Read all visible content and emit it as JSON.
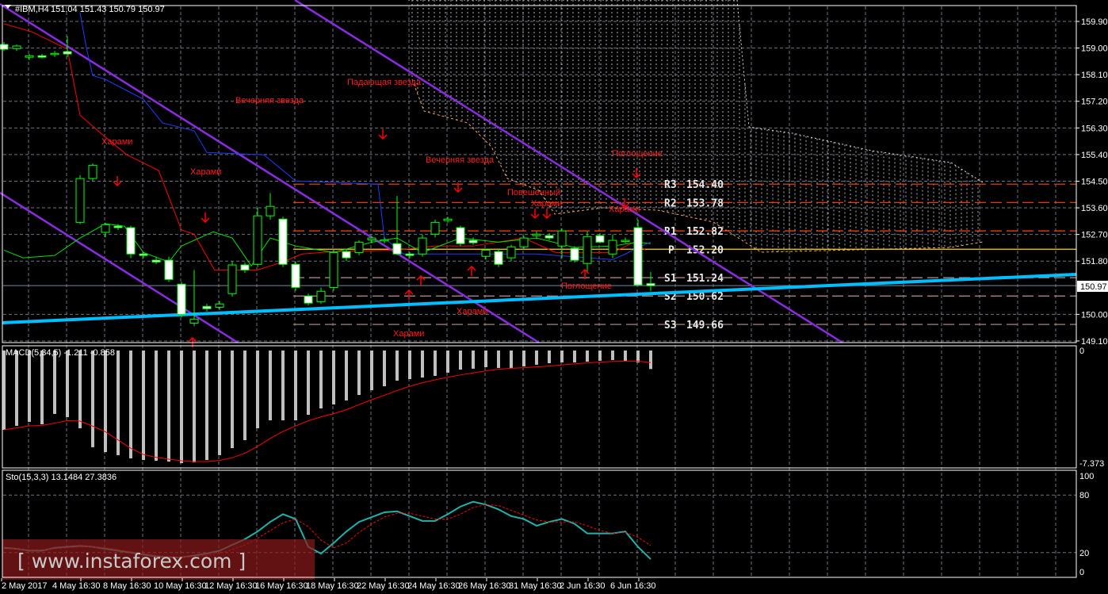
{
  "header": {
    "symbol": "#IBM,H4",
    "ohlc": "151.04 151.43 150.79 150.97"
  },
  "colors": {
    "background": "#000000",
    "bull_outline": "#00ff00",
    "bear_body": "#ffffff",
    "channel": "#8a2be2",
    "support": "#00bfff",
    "resistance": "#ff4500",
    "support_levels": "#bc8f8f",
    "pivot": "#ffd700",
    "macd_hist": "#c0c0c0",
    "signal": "#ff0000",
    "stoch_main": "#20b2aa"
  },
  "price_axis": {
    "ticks": [
      "159.90",
      "159.00",
      "158.10",
      "157.20",
      "156.30",
      "155.40",
      "154.50",
      "153.60",
      "152.70",
      "151.80",
      "150.00",
      "149.10"
    ],
    "current": "150.97"
  },
  "time_axis": [
    "2 May 2017",
    "4 May 16:30",
    "8 May 16:30",
    "10 May 16:30",
    "12 May 16:30",
    "16 May 16:30",
    "18 May 16:30",
    "22 May 16:30",
    "24 May 16:30",
    "26 May 16:30",
    "31 May 16:30",
    "2 Jun 16:30",
    "6 Jun 16:30"
  ],
  "pivots": [
    {
      "label": "R3",
      "value": "154.40"
    },
    {
      "label": "R2",
      "value": "153.78"
    },
    {
      "label": "R1",
      "value": "152.82"
    },
    {
      "label": "P",
      "value": "152.20"
    },
    {
      "label": "S1",
      "value": "151.24"
    },
    {
      "label": "S2",
      "value": "150.62"
    },
    {
      "label": "S3",
      "value": "149.66"
    }
  ],
  "patterns": [
    "Харами",
    "Вечерняя звезда",
    "Харами",
    "Падающая звезда",
    "Вечерняя звезда",
    "Повешенный",
    "Харами",
    "Поглощение",
    "Харами",
    "Поглощение",
    "Харами",
    "Харами"
  ],
  "macd": {
    "label": "MACD(5,34,5) -1.211 -0.858",
    "axis_top": "0",
    "axis_bottom": "-7.373"
  },
  "stoch": {
    "label": "Sto(15,3,3) 13.1484 27.3836",
    "axis": [
      "100",
      "80",
      "20",
      "0"
    ]
  },
  "watermark": "[ www.instaforex.com ]",
  "chart_data": {
    "type": "candlestick",
    "candles_ohlc": [
      [
        159.12,
        159.2,
        158.9,
        158.96
      ],
      [
        158.98,
        159.12,
        158.9,
        159.07
      ],
      [
        158.69,
        158.8,
        158.6,
        158.74
      ],
      [
        158.74,
        158.8,
        158.65,
        158.69
      ],
      [
        158.78,
        158.9,
        158.7,
        158.82
      ],
      [
        158.88,
        159.4,
        158.7,
        158.8
      ],
      [
        153.11,
        154.7,
        153.05,
        154.59
      ],
      [
        154.59,
        155.1,
        154.5,
        155.04
      ],
      [
        152.77,
        153.1,
        152.6,
        153.03
      ],
      [
        152.98,
        153.05,
        152.85,
        152.93
      ],
      [
        152.93,
        153.0,
        151.9,
        152.04
      ],
      [
        152.04,
        152.1,
        151.9,
        151.99
      ],
      [
        151.83,
        151.95,
        151.7,
        151.77
      ],
      [
        151.83,
        151.95,
        151.1,
        151.18
      ],
      [
        151.02,
        151.1,
        149.9,
        150.0
      ],
      [
        149.7,
        151.5,
        149.6,
        149.84
      ],
      [
        150.27,
        150.35,
        150.1,
        150.19
      ],
      [
        150.24,
        150.45,
        150.15,
        150.35
      ],
      [
        150.7,
        151.8,
        150.6,
        151.67
      ],
      [
        151.67,
        151.75,
        151.4,
        151.5
      ],
      [
        151.69,
        153.6,
        151.6,
        153.33
      ],
      [
        153.33,
        154.1,
        153.2,
        153.65
      ],
      [
        153.22,
        153.3,
        151.6,
        151.69
      ],
      [
        151.69,
        151.8,
        150.8,
        150.91
      ],
      [
        150.62,
        150.7,
        150.3,
        150.38
      ],
      [
        150.43,
        150.9,
        150.35,
        150.78
      ],
      [
        150.91,
        152.2,
        150.8,
        152.09
      ],
      [
        152.12,
        152.2,
        151.8,
        151.91
      ],
      [
        152.09,
        152.5,
        152.0,
        152.44
      ],
      [
        152.52,
        152.65,
        152.4,
        152.58
      ],
      [
        152.5,
        152.6,
        152.4,
        152.52
      ],
      [
        152.39,
        154.0,
        152.0,
        152.04
      ],
      [
        152.04,
        152.1,
        151.9,
        151.99
      ],
      [
        152.04,
        152.7,
        151.95,
        152.58
      ],
      [
        152.71,
        153.2,
        152.6,
        153.11
      ],
      [
        153.17,
        153.3,
        153.1,
        153.22
      ],
      [
        152.93,
        153.0,
        152.3,
        152.39
      ],
      [
        152.5,
        152.6,
        152.35,
        152.42
      ],
      [
        151.96,
        152.2,
        151.85,
        152.17
      ],
      [
        152.12,
        152.2,
        151.6,
        151.69
      ],
      [
        151.91,
        152.35,
        151.8,
        152.28
      ],
      [
        152.28,
        152.65,
        152.2,
        152.58
      ],
      [
        152.66,
        152.8,
        152.55,
        152.71
      ],
      [
        152.66,
        152.75,
        152.5,
        152.58
      ],
      [
        152.31,
        152.9,
        151.9,
        152.82
      ],
      [
        152.23,
        152.3,
        151.75,
        151.83
      ],
      [
        151.72,
        152.8,
        151.4,
        152.63
      ],
      [
        152.66,
        152.75,
        152.4,
        152.44
      ],
      [
        152.04,
        152.7,
        151.9,
        152.5
      ],
      [
        152.47,
        152.6,
        152.4,
        152.5
      ],
      [
        152.93,
        153.2,
        150.95,
        150.99
      ],
      [
        151.04,
        151.43,
        150.79,
        150.97
      ]
    ],
    "ma_red": [
      [
        0,
        159.82
      ],
      [
        2.2,
        159.55
      ],
      [
        5,
        158.96
      ],
      [
        6,
        156.73
      ],
      [
        7.8,
        156.06
      ],
      [
        9.7,
        155.39
      ],
      [
        12.2,
        154.86
      ],
      [
        14,
        152.85
      ],
      [
        15,
        152.71
      ],
      [
        16.6,
        151.5
      ],
      [
        20,
        151.5
      ],
      [
        22,
        151.77
      ],
      [
        23.5,
        152.04
      ],
      [
        26,
        152.12
      ],
      [
        31,
        152.17
      ],
      [
        34,
        152.31
      ],
      [
        37,
        152.31
      ],
      [
        41,
        152.58
      ],
      [
        43.5,
        152.09
      ],
      [
        48,
        152.09
      ],
      [
        49.7,
        152.44
      ],
      [
        50.6,
        152.17
      ]
    ],
    "ma_green": [
      [
        0,
        152.17
      ],
      [
        1.5,
        151.91
      ],
      [
        4,
        151.99
      ],
      [
        6,
        152.58
      ],
      [
        8,
        153.06
      ],
      [
        9.5,
        152.98
      ],
      [
        11,
        152.09
      ],
      [
        13,
        151.77
      ],
      [
        14,
        152.31
      ],
      [
        16.5,
        152.79
      ],
      [
        18,
        152.58
      ],
      [
        19.5,
        151.64
      ],
      [
        21,
        152.58
      ],
      [
        23,
        152.31
      ],
      [
        26,
        152.09
      ],
      [
        29,
        152.44
      ],
      [
        31,
        152.58
      ],
      [
        33,
        152.09
      ],
      [
        36,
        152.58
      ],
      [
        39,
        152.44
      ],
      [
        42,
        152.58
      ],
      [
        45,
        152.26
      ],
      [
        48,
        152.31
      ],
      [
        50,
        152.44
      ],
      [
        51,
        152.39
      ]
    ],
    "ma_blue": [
      [
        6,
        160.2
      ],
      [
        6.5,
        159.01
      ],
      [
        7,
        158.07
      ],
      [
        8,
        157.94
      ],
      [
        11,
        157.27
      ],
      [
        12.5,
        156.47
      ],
      [
        15,
        156.2
      ],
      [
        16,
        155.47
      ],
      [
        20.5,
        155.39
      ],
      [
        23,
        154.51
      ],
      [
        29.5,
        154.4
      ],
      [
        30,
        152.58
      ],
      [
        31.5,
        152.04
      ],
      [
        38,
        152.04
      ],
      [
        42,
        152.04
      ],
      [
        48,
        151.85
      ],
      [
        49,
        152.04
      ],
      [
        50,
        152.26
      ],
      [
        51,
        152.44
      ]
    ],
    "macd_hist": [
      -5.19,
      -4.93,
      -4.67,
      -4.83,
      -4.15,
      -4.36,
      -5.09,
      -6.33,
      -6.65,
      -6.85,
      -7.06,
      -7.17,
      -7.22,
      -7.27,
      -7.37,
      -7.32,
      -7.17,
      -6.85,
      -6.39,
      -5.87,
      -5.09,
      -4.57,
      -4.57,
      -4.57,
      -4.21,
      -3.79,
      -3.53,
      -3.27,
      -2.91,
      -2.6,
      -2.34,
      -1.97,
      -1.87,
      -1.77,
      -1.66,
      -1.45,
      -1.25,
      -1.19,
      -1.09,
      -1.14,
      -1.14,
      -1.04,
      -0.93,
      -0.83,
      -0.78,
      -0.78,
      -0.73,
      -0.67,
      -0.62,
      -0.67,
      -0.78,
      -1.211
    ],
    "stoch_main": [
      25,
      24,
      22,
      22,
      25,
      26,
      27,
      26,
      24,
      22,
      20,
      18,
      16,
      15,
      15,
      17,
      19,
      22,
      28,
      34,
      42,
      52,
      60,
      55,
      26,
      19,
      30,
      42,
      52,
      57,
      62,
      63,
      58,
      53,
      53,
      60,
      68,
      73,
      70,
      65,
      58,
      55,
      48,
      52,
      55,
      50,
      40,
      40,
      40,
      42,
      26,
      13.15
    ],
    "stoch_signal": [
      24,
      24,
      23,
      23,
      24,
      25,
      26,
      26,
      25,
      23,
      21,
      19,
      17,
      16,
      15,
      16,
      17,
      19,
      23,
      28,
      35,
      43,
      51,
      55,
      47,
      33,
      25,
      30,
      41,
      50,
      57,
      61,
      61,
      58,
      55,
      55,
      60,
      67,
      70,
      69,
      64,
      59,
      54,
      52,
      52,
      52,
      48,
      43,
      40,
      41,
      36,
      27.38
    ],
    "ylim": [
      149.1,
      159.9
    ]
  }
}
